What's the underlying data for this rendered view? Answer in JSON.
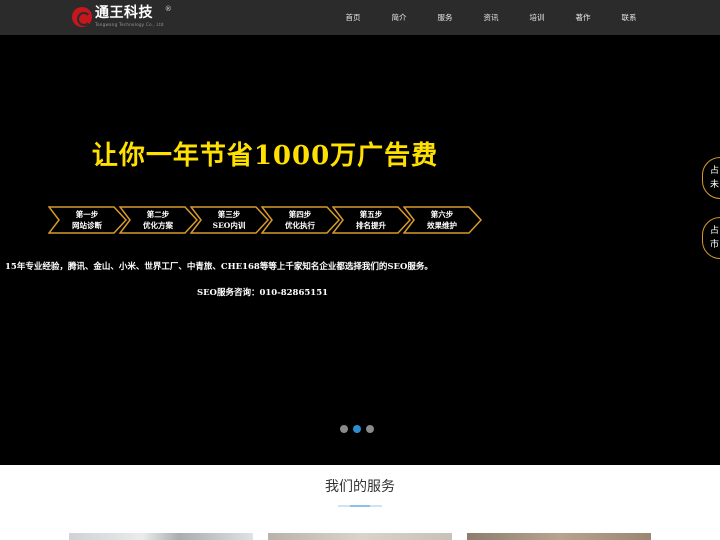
{
  "brand": {
    "name_cn": "通王科技",
    "name_en": "Tongwang Technology Co., Ltd",
    "registered": "®"
  },
  "nav": [
    {
      "label": "首页"
    },
    {
      "label": "简介"
    },
    {
      "label": "服务"
    },
    {
      "label": "资讯"
    },
    {
      "label": "培训"
    },
    {
      "label": "著作"
    },
    {
      "label": "联系"
    }
  ],
  "banner": {
    "headline": "让你一年节省1000万广告费",
    "steps": [
      {
        "step": "第一步",
        "title": "网站诊断"
      },
      {
        "step": "第二步",
        "title": "优化方案"
      },
      {
        "step": "第三步",
        "title": "SEO内训"
      },
      {
        "step": "第四步",
        "title": "优化执行"
      },
      {
        "step": "第五步",
        "title": "排名提升"
      },
      {
        "step": "第六步",
        "title": "效果维护"
      }
    ],
    "tagline": "15年专业经验，腾讯、金山、小米、世界工厂、中青旅、CHE168等等上千家知名企业都选择我们的SEO服务。",
    "contact": "SEO服务咨询：010-82865151",
    "side_badges": [
      {
        "text": "占未"
      },
      {
        "text": "占市"
      }
    ],
    "slides_total": 3,
    "active_slide": 2,
    "colors": {
      "headline": "#ffe000",
      "step_border": "#d89b2b",
      "active_dot": "#2a8ecf"
    }
  },
  "services": {
    "title": "我们的服务"
  }
}
